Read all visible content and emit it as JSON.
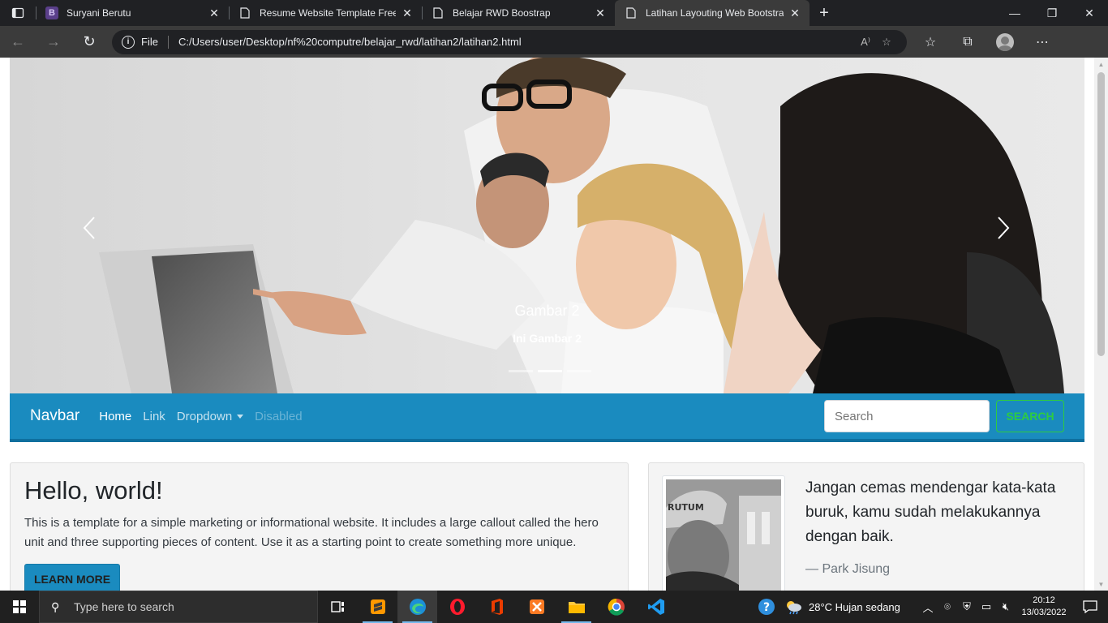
{
  "browser": {
    "tabs": [
      {
        "title": "Suryani Berutu",
        "favicon": "bootstrap-icon",
        "favicon_letter": "B",
        "active": false
      },
      {
        "title": "Resume Website Template Free D",
        "favicon": "page-icon",
        "active": false
      },
      {
        "title": "Belajar RWD Boostrap",
        "favicon": "page-icon",
        "active": false
      },
      {
        "title": "Latihan Layouting Web Bootstrap",
        "favicon": "page-icon",
        "active": true
      }
    ],
    "new_tab": "+",
    "address": {
      "scheme_label": "File",
      "url": "C:/Users/user/Desktop/nf%20computre/belajar_rwd/latihan2/latihan2.html"
    }
  },
  "page": {
    "carousel": {
      "caption_title": "Gambar 2",
      "caption_text": "Ini Gambar 2",
      "slide_count": 3,
      "active_slide": 2
    },
    "navbar": {
      "brand": "Navbar",
      "links": {
        "home": "Home",
        "link": "Link",
        "dropdown": "Dropdown",
        "disabled": "Disabled"
      },
      "search_placeholder": "Search",
      "search_button": "SEARCH",
      "accent_color": "#1a8bbf",
      "search_button_color": "#2ecc40"
    },
    "jumbotron": {
      "heading": "Hello, world!",
      "text": "This is a template for a simple marketing or informational website. It includes a large callout called the hero unit and three supporting pieces of content. Use it as a starting point to create something more unique.",
      "button": "LEARN MORE"
    },
    "quote": {
      "text": "Jangan cemas mendengar kata-kata buruk, kamu sudah melakukannya dengan baik.",
      "author": "Park Jisung",
      "author_dash": "—",
      "image_text": "RUTUM"
    }
  },
  "taskbar": {
    "search_placeholder": "Type here to search",
    "weather": "28°C  Hujan sedang",
    "time": "20:12",
    "date": "13/03/2022"
  }
}
